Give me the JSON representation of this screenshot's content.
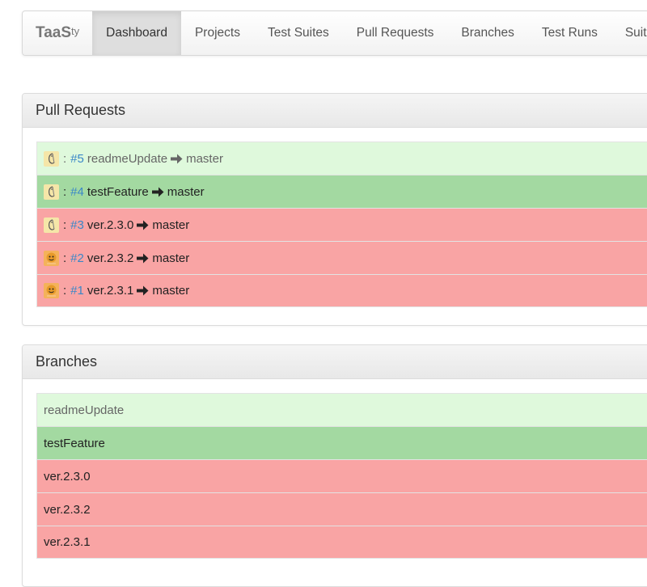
{
  "navbar": {
    "brand": "TaaS",
    "brand_sup": "ty",
    "items": [
      {
        "label": "Dashboard",
        "active": true
      },
      {
        "label": "Projects",
        "active": false
      },
      {
        "label": "Test Suites",
        "active": false
      },
      {
        "label": "Pull Requests",
        "active": false
      },
      {
        "label": "Branches",
        "active": false
      },
      {
        "label": "Test Runs",
        "active": false
      },
      {
        "label": "Suites",
        "active": false
      }
    ]
  },
  "pull_requests": {
    "title": "Pull Requests",
    "separator": ":",
    "items": [
      {
        "number": "#5",
        "source": "readmeUpdate",
        "target": "master",
        "status": "open",
        "avatar": "user1"
      },
      {
        "number": "#4",
        "source": "testFeature",
        "target": "master",
        "status": "pass",
        "avatar": "user1"
      },
      {
        "number": "#3",
        "source": "ver.2.3.0",
        "target": "master",
        "status": "fail",
        "avatar": "user1"
      },
      {
        "number": "#2",
        "source": "ver.2.3.2",
        "target": "master",
        "status": "fail",
        "avatar": "user2"
      },
      {
        "number": "#1",
        "source": "ver.2.3.1",
        "target": "master",
        "status": "fail",
        "avatar": "user2"
      }
    ]
  },
  "branches": {
    "title": "Branches",
    "items": [
      {
        "name": "readmeUpdate",
        "status": "open"
      },
      {
        "name": "testFeature",
        "status": "pass"
      },
      {
        "name": "ver.2.3.0",
        "status": "fail"
      },
      {
        "name": "ver.2.3.2",
        "status": "fail"
      },
      {
        "name": "ver.2.3.1",
        "status": "fail"
      }
    ]
  },
  "colors": {
    "open": "#dff9dc",
    "pass": "#a3d9a1",
    "fail": "#f9a4a4",
    "link": "#3a87c8"
  },
  "icons": {
    "arrow": "arrow-right-icon",
    "user1": "avatar-sketch-icon",
    "user2": "avatar-emoji-icon"
  }
}
